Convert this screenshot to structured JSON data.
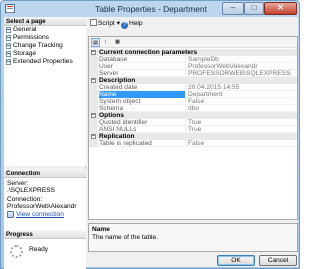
{
  "window": {
    "title": "Table Properties - Department",
    "minimize": "–",
    "maximize": "□",
    "close": "✕"
  },
  "left": {
    "select_page_heading": "Select a page",
    "pages": [
      "General",
      "Permissions",
      "Change Tracking",
      "Storage",
      "Extended Properties"
    ],
    "connection_heading": "Connection",
    "server_label": "Server:",
    "server_value": ".\\SQLEXPRESS",
    "connection_label": "Connection:",
    "connection_value": "ProfessorWeb\\Alexandr",
    "view_connection_link": "View connection",
    "progress_heading": "Progress",
    "progress_status": "Ready"
  },
  "toolbar": {
    "script_label": "Script",
    "script_dropdown": "▾",
    "help_label": "Help"
  },
  "grid": {
    "categories": [
      {
        "name": "Current connection parameters",
        "rows": [
          {
            "name": "Database",
            "value": "SampleDb"
          },
          {
            "name": "User",
            "value": "ProfessorWeb\\Alexandr"
          },
          {
            "name": "Server",
            "value": "PROFESSORWEB\\SQLEXPRESS"
          }
        ]
      },
      {
        "name": "Description",
        "rows": [
          {
            "name": "Created date",
            "value": "20.04.2015 14:55"
          },
          {
            "name": "Name",
            "value": "Department"
          },
          {
            "name": "System object",
            "value": "False"
          },
          {
            "name": "Schema",
            "value": "dbo"
          }
        ]
      },
      {
        "name": "Options",
        "rows": [
          {
            "name": "Quoted identifier",
            "value": "True"
          },
          {
            "name": "ANSI NULLs",
            "value": "True"
          }
        ]
      },
      {
        "name": "Replication",
        "rows": [
          {
            "name": "Table is replicated",
            "value": "False"
          }
        ]
      }
    ],
    "selected_row": "Name"
  },
  "description": {
    "title": "Name",
    "text": "The name of the table."
  },
  "buttons": {
    "ok": "OK",
    "cancel": "Cancel"
  },
  "colors": {
    "selection": "#3399ff",
    "link": "#1a4fb8"
  }
}
